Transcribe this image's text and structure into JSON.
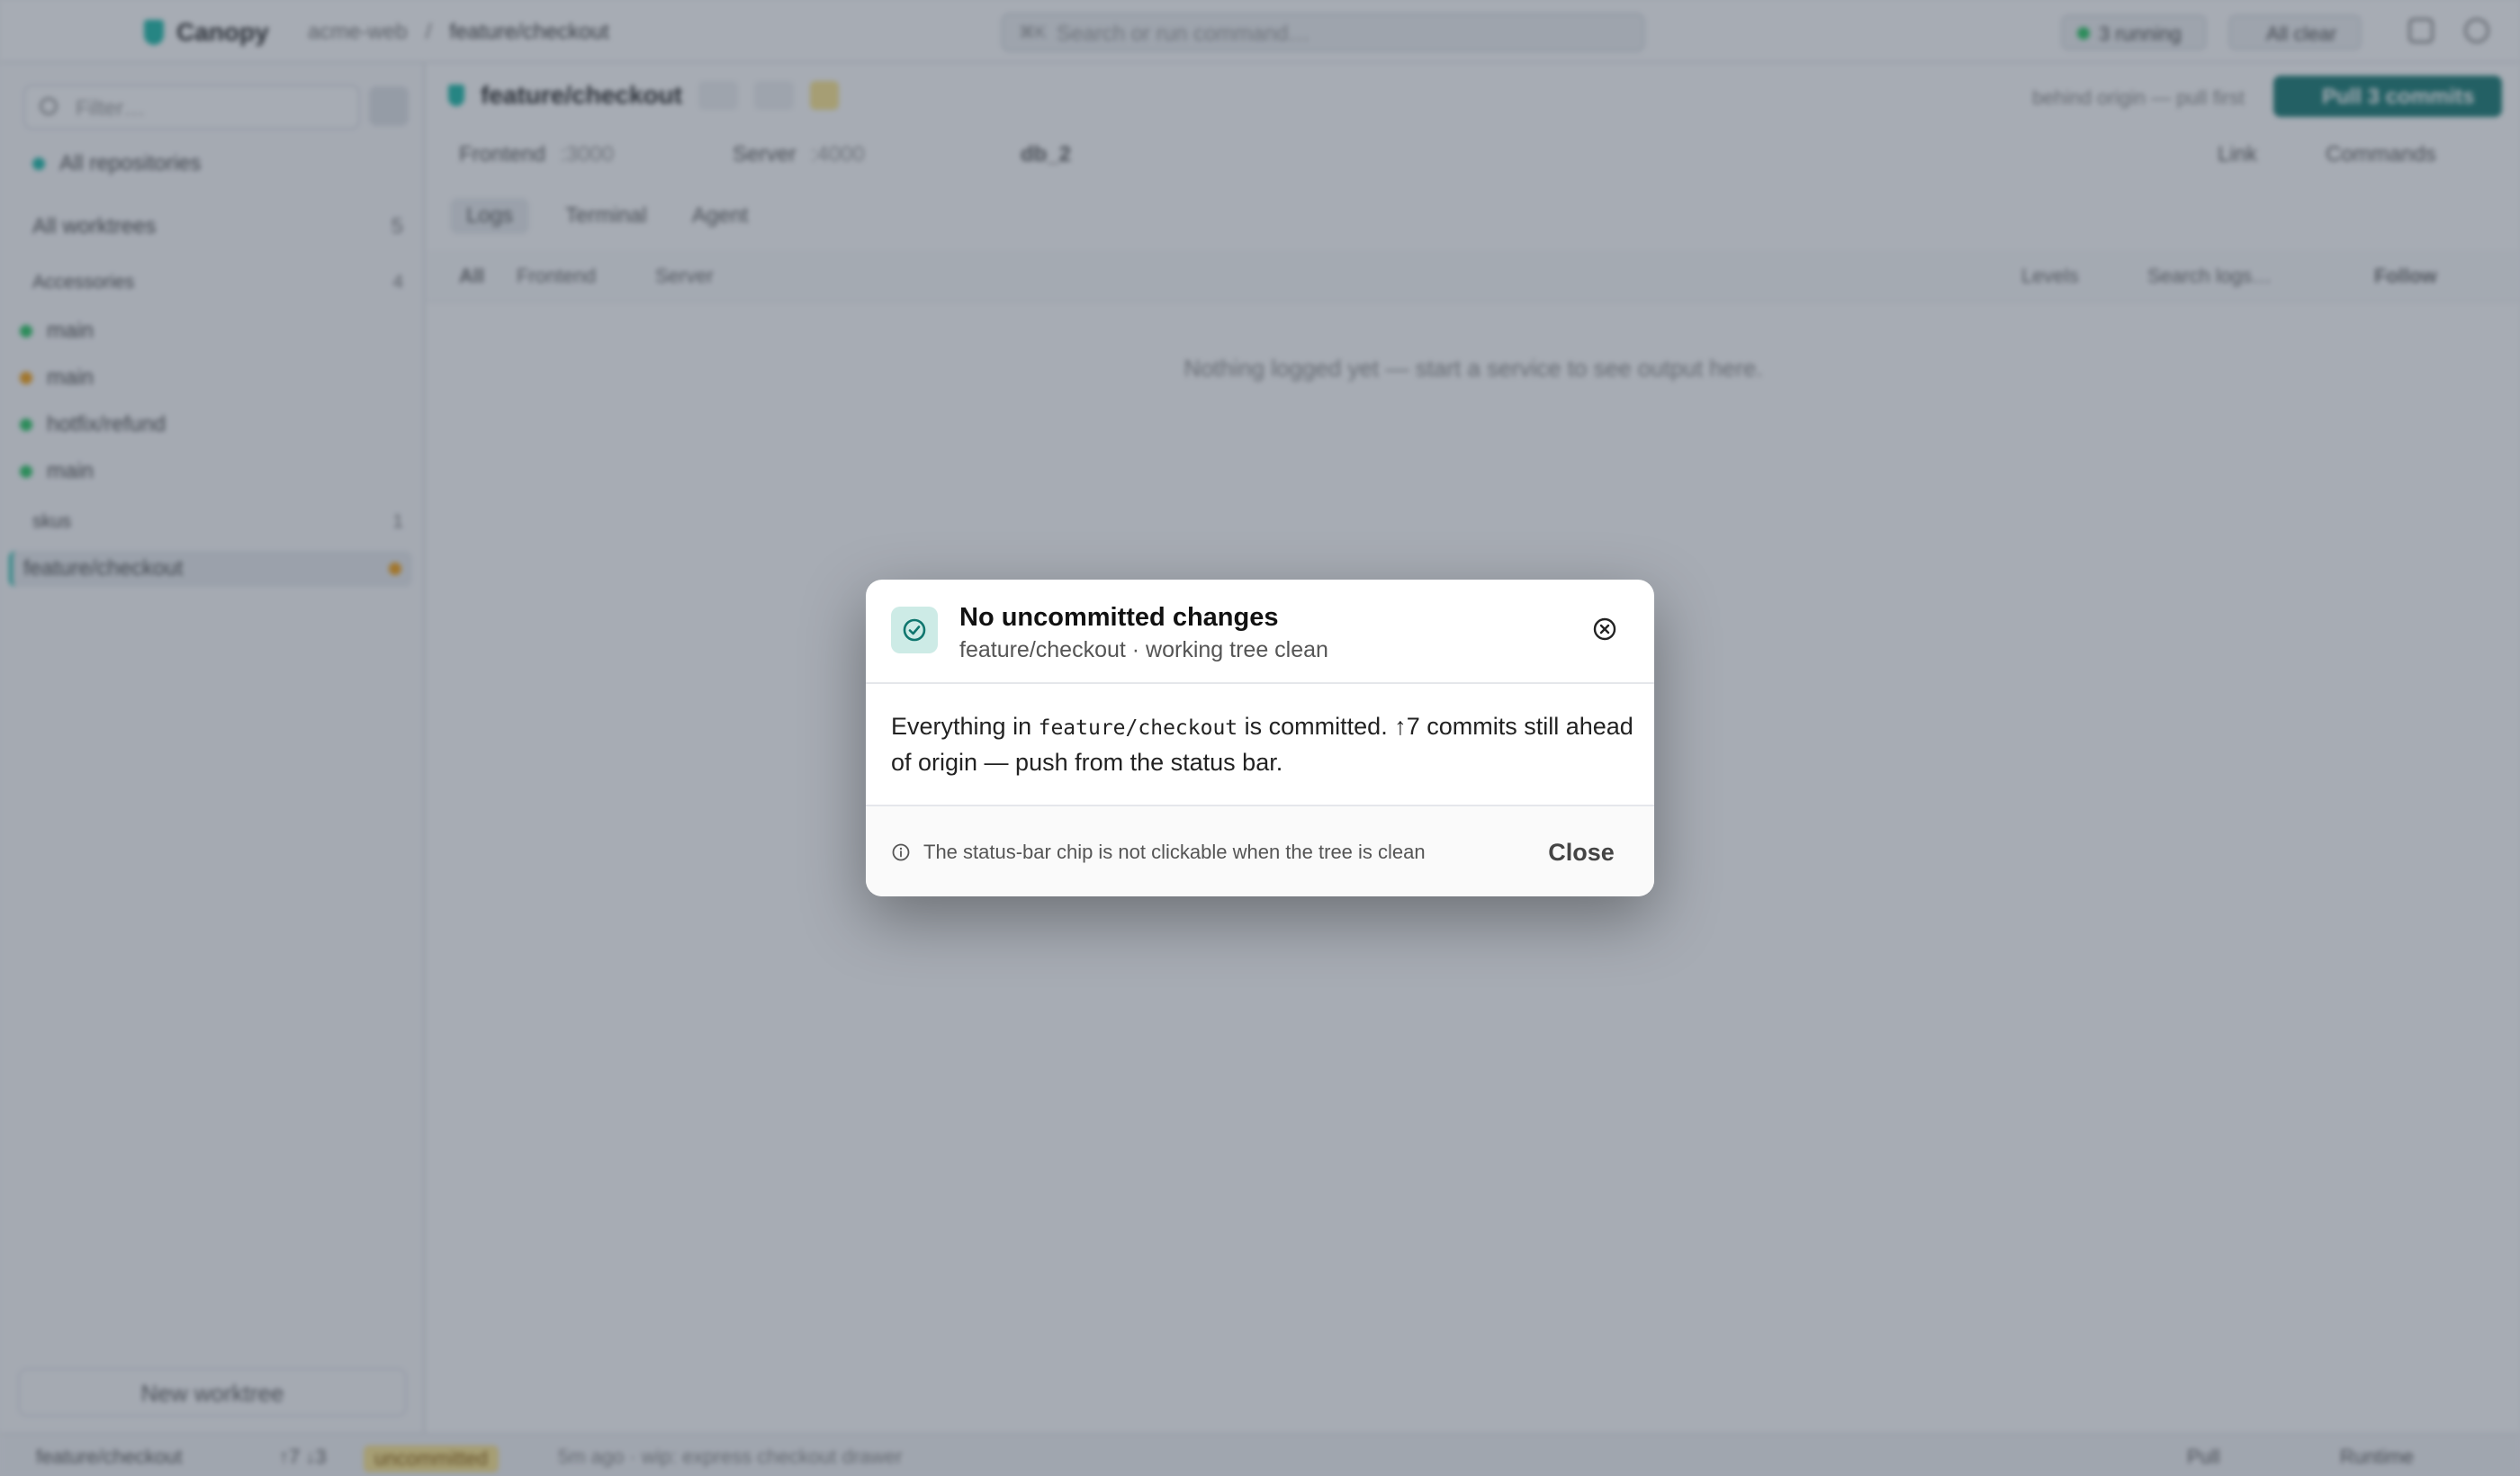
{
  "topbar": {
    "app_name": "Canopy",
    "breadcrumb_repo": "acme-web",
    "breadcrumb_sep": "/",
    "breadcrumb_branch": "feature/checkout",
    "command_placeholder": "Search or run command…",
    "command_shortcut": "⌘K",
    "running_label": "3 running",
    "allclear_label": "All clear"
  },
  "sidebar": {
    "filter_placeholder": "Filter…",
    "all_repositories": "All repositories",
    "all_worktrees": "All worktrees",
    "all_worktrees_count": "5",
    "group1_name": "Accessories",
    "group1_count": "4",
    "items": [
      {
        "label": "main"
      },
      {
        "label": "main"
      },
      {
        "label": "hotfix/refund"
      },
      {
        "label": "main"
      }
    ],
    "group2_name": "skus",
    "group2_count": "1",
    "selected_item": "feature/checkout",
    "new_worktree": "New worktree"
  },
  "main": {
    "title": "feature/checkout",
    "behind_text": "behind origin — pull first",
    "pull_button": "Pull 3 commits",
    "service_frontend": "Frontend",
    "service_frontend_port": ":3000",
    "service_server": "Server",
    "service_server_port": ":4000",
    "db_label": "db_2",
    "link_label": "Link",
    "commands_label": "Commands",
    "tabs": [
      "Logs",
      "Terminal",
      "Agent"
    ],
    "filter_all": "All",
    "filter_frontend": "Frontend",
    "filter_server": "Server",
    "levels_label": "Levels",
    "search_logs_placeholder": "Search logs…",
    "follow_label": "Follow",
    "empty_message": "Nothing logged yet — start a service to see output here."
  },
  "statusbar": {
    "branch": "feature/checkout",
    "ahead": "↑7  ↓3",
    "uncommitted": "uncommitted",
    "last_commit": "5m ago · wip: express checkout drawer",
    "pull": "Pull",
    "runtime": "Runtime"
  },
  "modal": {
    "title": "No uncommitted changes",
    "subtitle": "feature/checkout · working tree clean",
    "body_before": "Everything in ",
    "body_code": "feature/checkout",
    "body_after": " is committed. ↑7 commits still ahead of origin — push from the status bar.",
    "hint": "The status-bar chip is not clickable when the tree is clean",
    "close_button": "Close",
    "accent_color": "#0f766e"
  }
}
